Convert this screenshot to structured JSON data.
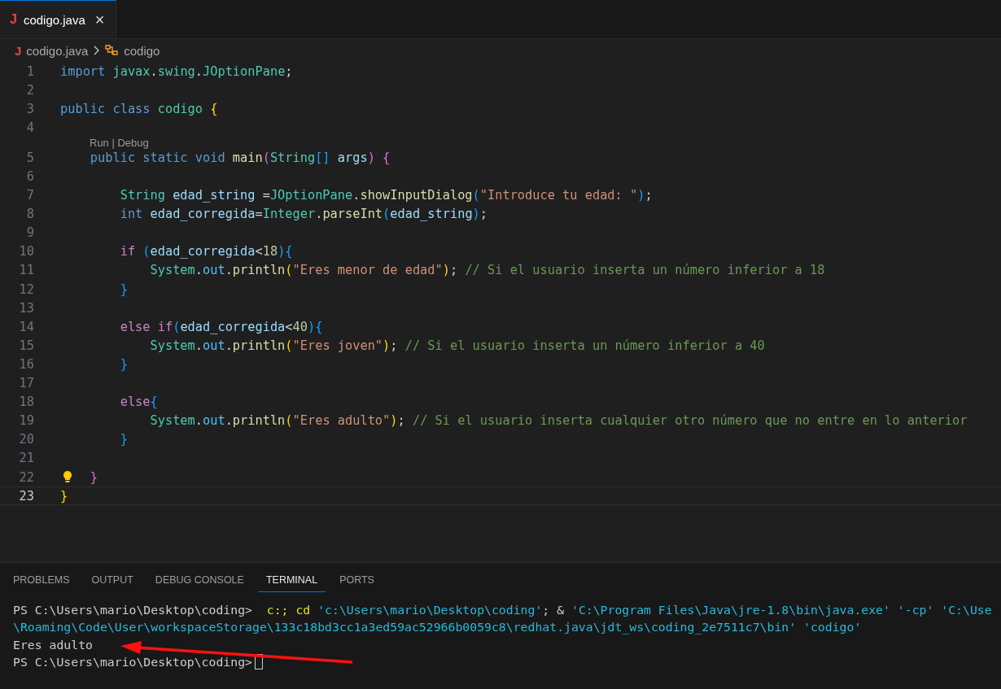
{
  "tabs": [
    {
      "file_icon": "J",
      "label": "codigo.java",
      "close": "×",
      "selected": true
    }
  ],
  "breadcrumb": {
    "file_icon": "J",
    "file": "codigo.java",
    "symbol": "codigo"
  },
  "editor": {
    "lines": [
      {
        "number": "1",
        "tokens": [
          {
            "text": "import ",
            "kind": "kw"
          },
          {
            "text": "javax",
            "kind": "t"
          },
          {
            "text": ".",
            "kind": "p"
          },
          {
            "text": "swing",
            "kind": "t"
          },
          {
            "text": ".",
            "kind": "p"
          },
          {
            "text": "JOptionPane",
            "kind": "t"
          },
          {
            "text": ";",
            "kind": "p"
          }
        ],
        "current": false,
        "lightbulb": false
      },
      {
        "number": "2",
        "current": false,
        "lightbulb": false
      },
      {
        "number": "3",
        "tokens": [
          {
            "text": "public class ",
            "kind": "kw"
          },
          {
            "text": "codigo ",
            "kind": "t"
          },
          {
            "text": "{",
            "kind": "b1"
          }
        ],
        "current": false,
        "lightbulb": false
      },
      {
        "number": "4",
        "current": false,
        "lightbulb": false
      },
      {
        "number": "5",
        "codelens": "Run | Debug",
        "tokens": [
          {
            "text": "    public static void ",
            "kind": "kw"
          },
          {
            "text": "main",
            "kind": "f"
          },
          {
            "text": "(",
            "kind": "b2"
          },
          {
            "text": "String",
            "kind": "t"
          },
          {
            "text": "[] ",
            "kind": "b3"
          },
          {
            "text": "args",
            "kind": "v"
          },
          {
            "text": ") ",
            "kind": "b2"
          },
          {
            "text": "{",
            "kind": "b2"
          }
        ],
        "current": false,
        "lightbulb": false
      },
      {
        "number": "6",
        "current": false,
        "lightbulb": false
      },
      {
        "number": "7",
        "tokens": [
          {
            "text": "        String ",
            "kind": "t"
          },
          {
            "text": "edad_string ",
            "kind": "v"
          },
          {
            "text": "=",
            "kind": "p"
          },
          {
            "text": "JOptionPane",
            "kind": "t"
          },
          {
            "text": ".",
            "kind": "p"
          },
          {
            "text": "showInputDialog",
            "kind": "f"
          },
          {
            "text": "(",
            "kind": "b3"
          },
          {
            "text": "\"Introduce tu edad: \"",
            "kind": "s"
          },
          {
            "text": ")",
            "kind": "b3"
          },
          {
            "text": ";",
            "kind": "p"
          }
        ],
        "current": false,
        "lightbulb": false
      },
      {
        "number": "8",
        "tokens": [
          {
            "text": "        int ",
            "kind": "kw"
          },
          {
            "text": "edad_corregida",
            "kind": "v"
          },
          {
            "text": "=",
            "kind": "p"
          },
          {
            "text": "Integer",
            "kind": "t"
          },
          {
            "text": ".",
            "kind": "p"
          },
          {
            "text": "parseInt",
            "kind": "f"
          },
          {
            "text": "(",
            "kind": "b3"
          },
          {
            "text": "edad_string",
            "kind": "v"
          },
          {
            "text": ")",
            "kind": "b3"
          },
          {
            "text": ";",
            "kind": "p"
          }
        ],
        "current": false,
        "lightbulb": false
      },
      {
        "number": "9",
        "current": false,
        "lightbulb": false
      },
      {
        "number": "10",
        "tokens": [
          {
            "text": "        if ",
            "kind": "c"
          },
          {
            "text": "(",
            "kind": "b3"
          },
          {
            "text": "edad_corregida",
            "kind": "v"
          },
          {
            "text": "<",
            "kind": "p"
          },
          {
            "text": "18",
            "kind": "n"
          },
          {
            "text": ")",
            "kind": "b3"
          },
          {
            "text": "{",
            "kind": "b3"
          }
        ],
        "current": false,
        "lightbulb": false
      },
      {
        "number": "11",
        "tokens": [
          {
            "text": "            System",
            "kind": "t"
          },
          {
            "text": ".",
            "kind": "p"
          },
          {
            "text": "out",
            "kind": "o"
          },
          {
            "text": ".",
            "kind": "p"
          },
          {
            "text": "println",
            "kind": "f"
          },
          {
            "text": "(",
            "kind": "b1"
          },
          {
            "text": "\"Eres menor de edad\"",
            "kind": "s"
          },
          {
            "text": ")",
            "kind": "b1"
          },
          {
            "text": "; ",
            "kind": "p"
          },
          {
            "text": "// Si el usuario inserta un número inferior a 18",
            "kind": "m"
          }
        ],
        "current": false,
        "lightbulb": false
      },
      {
        "number": "12",
        "tokens": [
          {
            "text": "        }",
            "kind": "b3"
          }
        ],
        "current": false,
        "lightbulb": false
      },
      {
        "number": "13",
        "current": false,
        "lightbulb": false
      },
      {
        "number": "14",
        "tokens": [
          {
            "text": "        else if",
            "kind": "c"
          },
          {
            "text": "(",
            "kind": "b3"
          },
          {
            "text": "edad_corregida",
            "kind": "v"
          },
          {
            "text": "<",
            "kind": "p"
          },
          {
            "text": "40",
            "kind": "n"
          },
          {
            "text": ")",
            "kind": "b3"
          },
          {
            "text": "{",
            "kind": "b3"
          }
        ],
        "current": false,
        "lightbulb": false
      },
      {
        "number": "15",
        "tokens": [
          {
            "text": "            System",
            "kind": "t"
          },
          {
            "text": ".",
            "kind": "p"
          },
          {
            "text": "out",
            "kind": "o"
          },
          {
            "text": ".",
            "kind": "p"
          },
          {
            "text": "println",
            "kind": "f"
          },
          {
            "text": "(",
            "kind": "b1"
          },
          {
            "text": "\"Eres joven\"",
            "kind": "s"
          },
          {
            "text": ")",
            "kind": "b1"
          },
          {
            "text": "; ",
            "kind": "p"
          },
          {
            "text": "// Si el usuario inserta un número inferior a 40",
            "kind": "m"
          }
        ],
        "current": false,
        "lightbulb": false
      },
      {
        "number": "16",
        "tokens": [
          {
            "text": "        }",
            "kind": "b3"
          }
        ],
        "current": false,
        "lightbulb": false
      },
      {
        "number": "17",
        "current": false,
        "lightbulb": false
      },
      {
        "number": "18",
        "tokens": [
          {
            "text": "        else",
            "kind": "c"
          },
          {
            "text": "{",
            "kind": "b3"
          }
        ],
        "current": false,
        "lightbulb": false
      },
      {
        "number": "19",
        "tokens": [
          {
            "text": "            System",
            "kind": "t"
          },
          {
            "text": ".",
            "kind": "p"
          },
          {
            "text": "out",
            "kind": "o"
          },
          {
            "text": ".",
            "kind": "p"
          },
          {
            "text": "println",
            "kind": "f"
          },
          {
            "text": "(",
            "kind": "b1"
          },
          {
            "text": "\"Eres adulto\"",
            "kind": "s"
          },
          {
            "text": ")",
            "kind": "b1"
          },
          {
            "text": "; ",
            "kind": "p"
          },
          {
            "text": "// Si el usuario inserta cualquier otro número que no entre en lo anterior",
            "kind": "m"
          }
        ],
        "current": false,
        "lightbulb": false
      },
      {
        "number": "20",
        "tokens": [
          {
            "text": "        }",
            "kind": "b3"
          }
        ],
        "current": false,
        "lightbulb": false
      },
      {
        "number": "21",
        "current": false,
        "lightbulb": false
      },
      {
        "number": "22",
        "tokens": [
          {
            "text": "    }",
            "kind": "b2"
          }
        ],
        "current": false,
        "lightbulb": true
      },
      {
        "number": "23",
        "tokens": [
          {
            "text": "}",
            "kind": "b1"
          }
        ],
        "current": true,
        "lightbulb": false
      }
    ]
  },
  "panel": {
    "tabs": [
      {
        "label": "PROBLEMS",
        "selected": false
      },
      {
        "label": "OUTPUT",
        "selected": false
      },
      {
        "label": "DEBUG CONSOLE",
        "selected": false
      },
      {
        "label": "TERMINAL",
        "selected": true
      },
      {
        "label": "PORTS",
        "selected": false
      }
    ],
    "terminal": [
      {
        "tokens": [
          {
            "text": "PS C:\\Users\\mario\\Desktop\\coding>  ",
            "kind": "plain"
          },
          {
            "text": "c:; cd ",
            "kind": "yel"
          },
          {
            "text": "'c:\\Users\\mario\\Desktop\\coding'",
            "kind": "cyan"
          },
          {
            "text": "; & ",
            "kind": "plain"
          },
          {
            "text": "'C:\\Program Files\\Java\\jre-1.8\\bin\\java.exe' '-cp' 'C:\\Use",
            "kind": "cyan"
          }
        ],
        "cursor": false
      },
      {
        "tokens": [
          {
            "text": "\\Roaming\\Code\\User\\workspaceStorage\\133c18bd3cc1a3ed59ac52966b0059c8\\redhat.java\\jdt_ws\\coding_2e7511c7\\bin' 'codigo'",
            "kind": "cyan"
          }
        ],
        "cursor": false
      },
      {
        "tokens": [
          {
            "text": "Eres adulto",
            "kind": "plain"
          }
        ],
        "cursor": false
      },
      {
        "tokens": [
          {
            "text": "PS C:\\Users\\mario\\Desktop\\coding>",
            "kind": "plain"
          }
        ],
        "cursor": true
      }
    ]
  }
}
